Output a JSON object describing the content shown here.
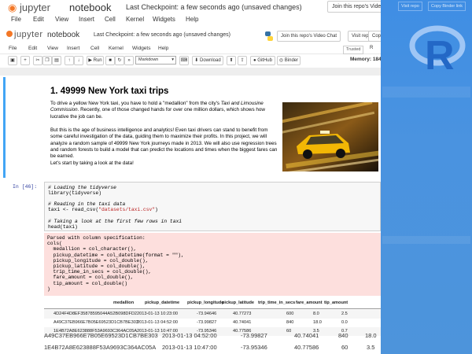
{
  "ghost_header": {
    "app": "jupyter",
    "notebook_name": "notebook",
    "checkpoint": "Last Checkpoint: a few seconds ago",
    "unsaved": "(unsaved changes)",
    "video_chat_button": "Join this repo's Video Chat",
    "visit_repo_button": "Visit repo",
    "copy_binder_button": "Copy Binder link",
    "menu": [
      "File",
      "Edit",
      "View",
      "Insert",
      "Cell",
      "Kernel",
      "Widgets",
      "Help"
    ]
  },
  "header": {
    "app": "jupyter",
    "notebook_name": "notebook",
    "checkpoint": "Last Checkpoint: a few seconds ago",
    "unsaved": "(unsaved changes)",
    "video_chat_button": "Join this repo's Video Chat",
    "visit_repo_button": "Visit repo",
    "copy_button": "Copy"
  },
  "menubar": {
    "items": [
      "File",
      "Edit",
      "View",
      "Insert",
      "Cell",
      "Kernel",
      "Widgets",
      "Help"
    ],
    "trusted": "Trusted",
    "kernel": "R"
  },
  "toolbar": {
    "run_label": "Run",
    "cell_type": "Markdown",
    "download_label": "Download",
    "github_label": "GitHub",
    "binder_label": "Binder",
    "memory": "Memory: 184"
  },
  "markdown": {
    "title": "1. 49999 New York taxi trips",
    "p1_a": "To drive a yellow New York taxi, you have to hold a \"medallion\" from the city's ",
    "p1_italic": "Taxi and Limousine Commission",
    "p1_b": ". Recently, one of those changed hands for over one million dollars, which shows how lucrative the job can be.",
    "p2": "But this is the age of business intelligence and analytics! Even taxi drivers can stand to benefit from some careful investigation of the data, guiding them to maximize their profits. In this project, we will analyze a random sample of 49999 New York journeys made in 2013. We will also use regression trees and random forests to build a model that can predict the locations and times when the biggest fares can be earned.",
    "p3": "Let's start by taking a look at the data!"
  },
  "code_cell": {
    "prompt": "In [46]:",
    "lines": [
      {
        "type": "comment",
        "text": "# Loading the tidyverse"
      },
      {
        "type": "code",
        "text": "library(tidyverse)"
      },
      {
        "type": "blank",
        "text": " "
      },
      {
        "type": "comment",
        "text": "# Reading in the taxi data"
      },
      {
        "type": "code_str",
        "pre": "taxi <- read_csv(",
        "str": "\"datasets/taxi.csv\"",
        "post": ")"
      },
      {
        "type": "blank",
        "text": " "
      },
      {
        "type": "comment",
        "text": "# Taking a look at the first few rows in taxi"
      },
      {
        "type": "code",
        "text": "head(taxi)"
      }
    ]
  },
  "stderr": {
    "lines": [
      "Parsed with column specification:",
      "cols(",
      "  medallion = col_character(),",
      "  pickup_datetime = col_datetime(format = \"\"),",
      "  pickup_longitude = col_double(),",
      "  pickup_latitude = col_double(),",
      "  trip_time_in_secs = col_double(),",
      "  fare_amount = col_double(),",
      "  tip_amount = col_double()",
      ")"
    ]
  },
  "table": {
    "columns": [
      "medallion",
      "pickup_datetime",
      "pickup_longitude",
      "pickup_latitude",
      "trip_time_in_secs",
      "fare_amount",
      "tip_amount"
    ],
    "rows": [
      [
        "4D24F4D8EF35878595044A52B098DFD2",
        "2013-01-13 10:23:00",
        "-73.94646",
        "40.77273",
        "600",
        "8.0",
        "2.5"
      ],
      [
        "A49C37EB966E7B05E69523D1CB7BE303",
        "2013-01-13 04:52:00",
        "-73.99827",
        "40.74041",
        "840",
        "18.0",
        "0.0"
      ],
      [
        "1E4B72A8E623888F53A9693C364AC05A",
        "2013-01-13 10:47:00",
        "-73.95346",
        "40.77586",
        "60",
        "3.5",
        "0.7"
      ]
    ]
  },
  "ghost_rows": [
    [
      "A49C37EB966E7B05E69523D1CB7BE303",
      "2013-01-13 04:52:00",
      "-73.99827",
      "40.74041",
      "840",
      "18.0"
    ],
    [
      "1E4B72A8E623888F53A9693C364AC05A",
      "2013-01-13 10:47:00",
      "-73.95346",
      "40.77586",
      "60",
      "3.5"
    ]
  ],
  "rpanel": {
    "visit_repo": "Visit repo",
    "copy_binder": "Copy Binder link",
    "logo_letter": "R"
  }
}
